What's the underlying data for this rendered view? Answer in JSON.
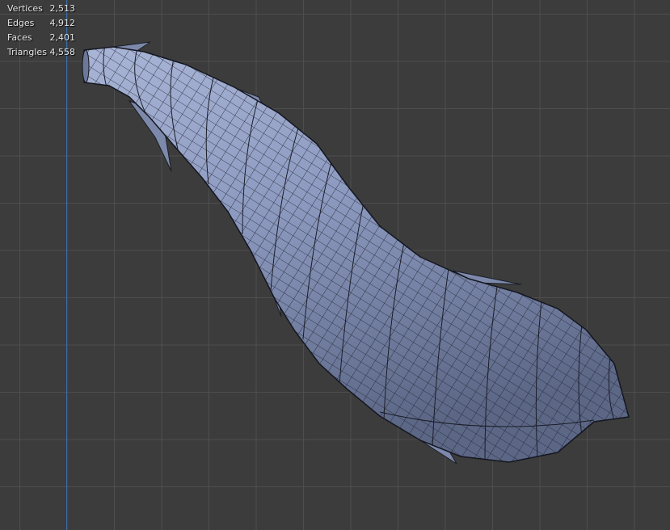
{
  "stats": {
    "rows": [
      {
        "label": "Vertices",
        "value": "2,513"
      },
      {
        "label": "Edges",
        "value": "4,912"
      },
      {
        "label": "Faces",
        "value": "2,401"
      },
      {
        "label": "Triangles",
        "value": "4,558"
      }
    ]
  },
  "colors": {
    "background": "#3c3c3c",
    "grid_line": "#505050",
    "y_axis": "#3c6ea8",
    "mesh_fill": "#8e9bbf",
    "mesh_wire": "#1a1d26"
  }
}
